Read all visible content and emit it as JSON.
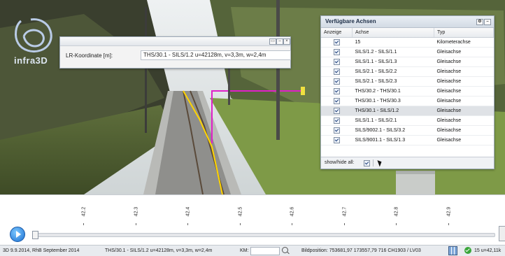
{
  "logo": {
    "text": "infra3D"
  },
  "coordinate_panel": {
    "label": "LR-Koordinate [m]:",
    "value": "THS/30.1 - SILS/1.2 u=42128m, v=3,3m, w=2,4m"
  },
  "axes_panel": {
    "title": "Verfügbare Achsen",
    "columns": [
      "Anzeige",
      "Achse",
      "Typ"
    ],
    "rows": [
      {
        "achse": "15",
        "typ": "Kilometerachse",
        "checked": true
      },
      {
        "achse": "SILS/1.2 - SILS/1.1",
        "typ": "Gleisachse",
        "checked": true
      },
      {
        "achse": "SILS/1.1 - SILS/1.3",
        "typ": "Gleisachse",
        "checked": true
      },
      {
        "achse": "SILS/2.1 - SILS/2.2",
        "typ": "Gleisachse",
        "checked": true
      },
      {
        "achse": "SILS/2.1 - SILS/2.3",
        "typ": "Gleisachse",
        "checked": true
      },
      {
        "achse": "THS/30.2 - THS/30.1",
        "typ": "Gleisachse",
        "checked": true
      },
      {
        "achse": "THS/30.1 - THS/30.3",
        "typ": "Gleisachse",
        "checked": true
      },
      {
        "achse": "THS/30.1 - SILS/1.2",
        "typ": "Gleisachse",
        "checked": true,
        "selected": true
      },
      {
        "achse": "SILS/1.1 - SILS/2.1",
        "typ": "Gleisachse",
        "checked": true
      },
      {
        "achse": "SILS/9002.1 - SILS/3.2",
        "typ": "Gleisachse",
        "checked": true
      },
      {
        "achse": "SILS/9001.1 - SILS/1.3",
        "typ": "Gleisachse",
        "checked": true
      }
    ],
    "footer_label": "show/hide all:"
  },
  "timeline": {
    "km_labels": [
      "42.2",
      "42.3",
      "42.4",
      "42.5",
      "42.6",
      "42.7",
      "42.8",
      "42.9"
    ]
  },
  "statusbar": {
    "session": "3D  9.9.2014, RhB September 2014",
    "coordinate": "THS/30.1 - SILS/1.2 u=42128m, v=3,3m, w=2,4m",
    "km_label": "KM:",
    "km_value": "",
    "image_position": "Bildposition: 753681,97 173557,79 716  CH1903 / LV03",
    "right_info": "15 u=42,11k"
  }
}
